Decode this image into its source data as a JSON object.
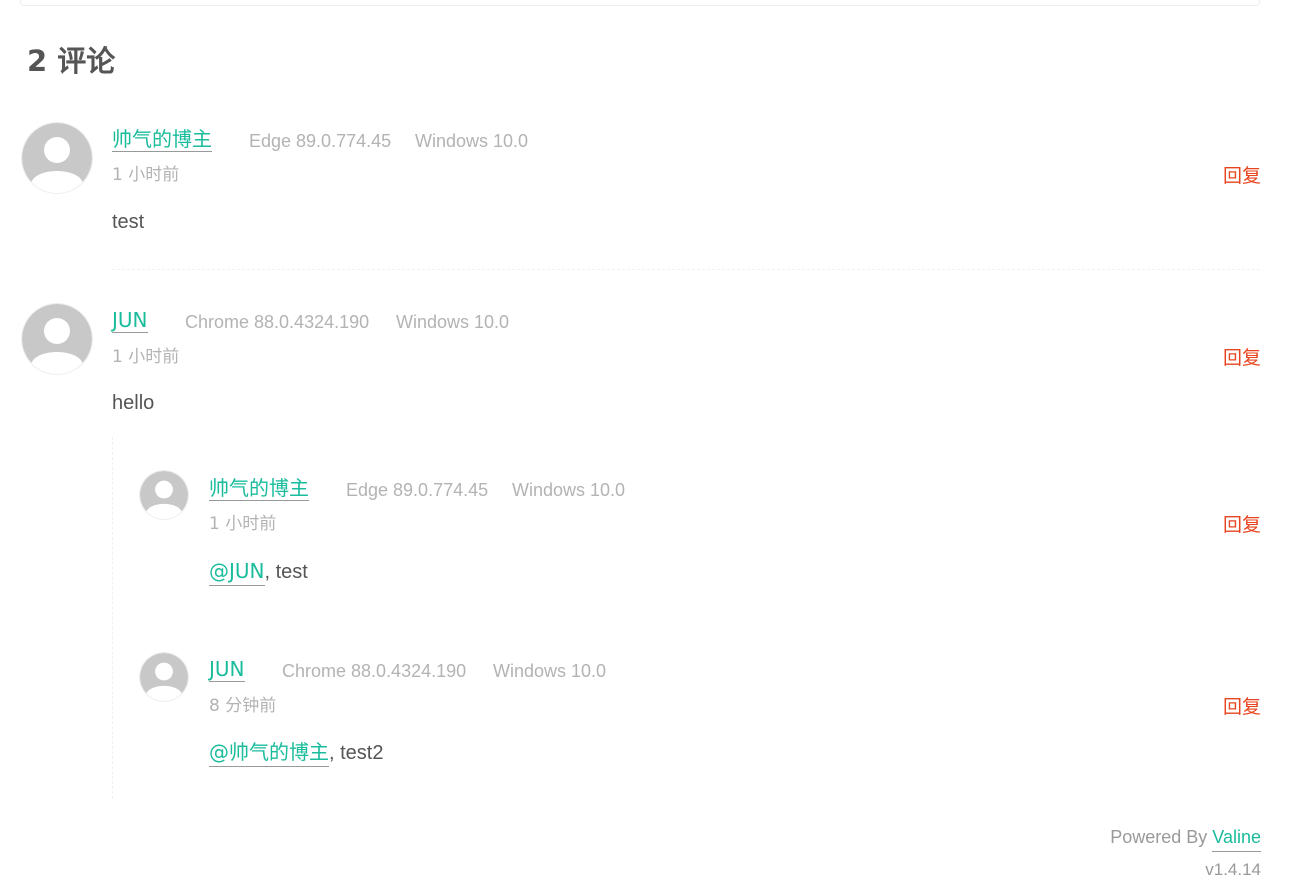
{
  "comments_title": "2 评论",
  "comments": [
    {
      "nick": "帅气的博主",
      "browser": "Edge 89.0.774.45",
      "os": "Windows 10.0",
      "time": "1 小时前",
      "reply_label": "回复",
      "content": "test"
    },
    {
      "nick": "JUN",
      "browser": "Chrome 88.0.4324.190",
      "os": "Windows 10.0",
      "time": "1 小时前",
      "reply_label": "回复",
      "content": "hello",
      "replies": [
        {
          "nick": "帅气的博主",
          "browser": "Edge 89.0.774.45",
          "os": "Windows 10.0",
          "time": "1 小时前",
          "reply_label": "回复",
          "at": "@JUN",
          "content": ", test"
        },
        {
          "nick": "JUN",
          "browser": "Chrome 88.0.4324.190",
          "os": "Windows 10.0",
          "time": "8 分钟前",
          "reply_label": "回复",
          "at": "@帅气的博主",
          "content": ", test2"
        }
      ]
    }
  ],
  "footer": {
    "powered_by": "Powered By",
    "link": "Valine",
    "version": "v1.4.14"
  },
  "colors": {
    "accent": "#1abc9c",
    "reply": "#e8451e",
    "muted": "#b3b3b3",
    "text": "#555555"
  },
  "icons": {
    "avatar": "default-avatar-icon"
  }
}
